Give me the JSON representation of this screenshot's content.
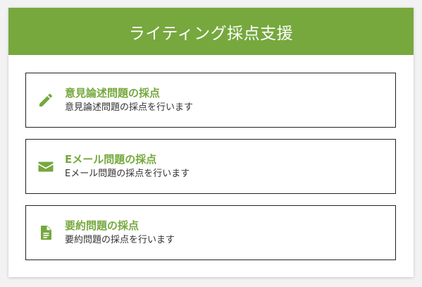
{
  "header": {
    "title": "ライティング採点支援"
  },
  "options": [
    {
      "icon": "pencil-icon",
      "title": "意見論述問題の採点",
      "description": "意見論述問題の採点を行います"
    },
    {
      "icon": "envelope-icon",
      "title": "Eメール問題の採点",
      "description": "Eメール問題の採点を行います"
    },
    {
      "icon": "document-icon",
      "title": "要約問題の採点",
      "description": "要約問題の採点を行います"
    }
  ],
  "colors": {
    "accent": "#76a83e",
    "header_text": "#ffffff",
    "border": "#222222",
    "description_text": "#333333"
  }
}
